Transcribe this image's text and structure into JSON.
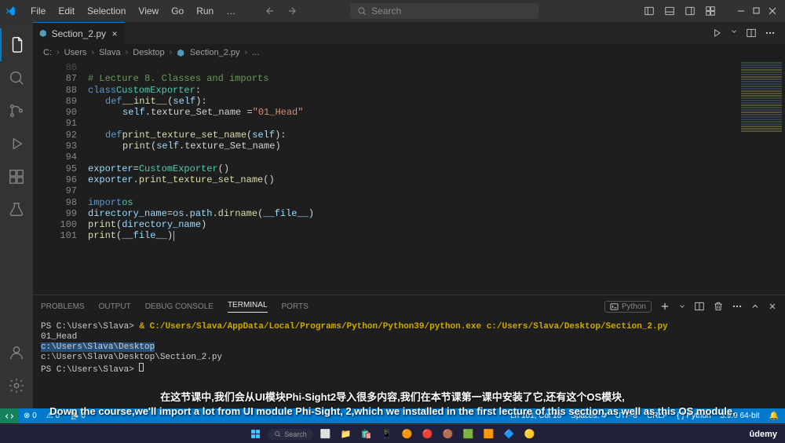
{
  "menu": {
    "file": "File",
    "edit": "Edit",
    "selection": "Selection",
    "view": "View",
    "go": "Go",
    "run": "Run",
    "more": "…"
  },
  "search_placeholder": "Search",
  "tab": {
    "name": "Section_2.py"
  },
  "breadcrumb": {
    "c": "C:",
    "users": "Users",
    "slava": "Slava",
    "desktop": "Desktop",
    "file": "Section_2.py",
    "more": "..."
  },
  "code": {
    "lines": [
      {
        "n": 86,
        "first": true,
        "html": ""
      },
      {
        "n": 87,
        "html": "<span class='t-comment'># Lecture 8. Classes and imports</span>"
      },
      {
        "n": 88,
        "html": "<span class='t-keyword'>class</span> <span class='t-class'>CustomExporter</span>:"
      },
      {
        "n": 89,
        "html": "<span class='ind1'></span><span class='t-keyword'>def</span> <span class='t-func'>__init__</span>(<span class='t-self'>self</span>):"
      },
      {
        "n": 90,
        "html": "<span class='ind1'></span><span class='ind2'></span><span class='t-self'>self</span>.texture_Set_name <span class='t-op'>=</span> <span class='t-string'>\"01_Head\"</span>"
      },
      {
        "n": 91,
        "html": "<span class='ind1'></span>"
      },
      {
        "n": 92,
        "html": "<span class='ind1'></span><span class='t-keyword'>def</span> <span class='t-func'>print_texture_set_name</span>(<span class='t-self'>self</span>):"
      },
      {
        "n": 93,
        "html": "<span class='ind1'></span><span class='ind2'></span><span class='t-func'>print</span>(<span class='t-self'>self</span>.texture_Set_name)"
      },
      {
        "n": 94,
        "html": ""
      },
      {
        "n": 95,
        "html": "<span class='t-self'>exporter</span> <span class='t-op'>=</span> <span class='t-class'>CustomExporter</span>()"
      },
      {
        "n": 96,
        "html": "<span class='t-self'>exporter</span>.<span class='t-func'>print_texture_set_name</span>()"
      },
      {
        "n": 97,
        "html": ""
      },
      {
        "n": 98,
        "html": "<span class='t-keyword'>import</span> <span class='t-class'>os</span>"
      },
      {
        "n": 99,
        "html": "<span class='t-self'>directory_name</span> <span class='t-op'>=</span> <span class='t-self'>os</span>.<span class='t-self'>path</span>.<span class='t-func'>dirname</span>(<span class='t-self'>__file__</span>)"
      },
      {
        "n": 100,
        "html": "<span class='t-func'>print</span>(<span class='t-self'>directory_name</span>)"
      },
      {
        "n": 101,
        "html": "<span class='t-func'>print</span>(<span class='t-self'>__file__</span>)<span class='cursor'></span>"
      }
    ]
  },
  "panel_tabs": {
    "problems": "PROBLEMS",
    "output": "OUTPUT",
    "debug": "DEBUG CONSOLE",
    "terminal": "TERMINAL",
    "ports": "PORTS",
    "lang": "Python"
  },
  "terminal": {
    "line1_prompt": "PS C:\\Users\\Slava>",
    "line1_cmd": "& C:/Users/Slava/AppData/Local/Programs/Python/Python39/python.exe c:/Users/Slava/Desktop/Section_2.py",
    "line2": "01_Head",
    "line3": "c:\\Users\\Slava\\Desktop",
    "line4": "c:\\Users\\Slava\\Desktop\\Section_2.py",
    "line5_prompt": "PS C:\\Users\\Slava>"
  },
  "status": {
    "errors": "0",
    "warnings": "0",
    "ports": "0",
    "lncol": "Ln 101, Col 18",
    "spaces": "Spaces: 4",
    "encoding": "UTF-8",
    "eol": "CRLF",
    "lang": "Python",
    "interpreter": "3.9.9 64-bit"
  },
  "subtitles": {
    "line1": "在这节课中,我们会从UI模块Phi-Sight2导入很多内容,我们在本节课第一课中安装了它,还有这个OS模块,",
    "line2": "Down the course,we'll import a lot from UI module Phi-Sight, 2,which we installed in the first lecture of this section,as well as this OS module,"
  },
  "taskbar_search": "Search",
  "udemy": "ûdemy"
}
